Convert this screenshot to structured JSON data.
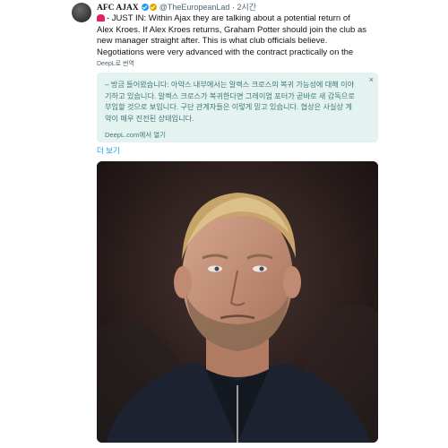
{
  "tweet": {
    "display_name": "AFC AJAX",
    "handle": "@TheEuropeanLad",
    "separator": "·",
    "time": "2시간",
    "text_lines": [
      "- JUST IN: Within Ajax they are talking about a potential return of",
      "Alex Kroes. If Alex Kroes returns, Graham Potter should join the club as",
      "new manager straight after. This is what club officials believe.",
      "Negotiations were very advanced with the contract practically on the"
    ],
    "deepl_label": "DeepL로 번역",
    "show_more": "더 보기"
  },
  "translation": {
    "lines": [
      "– 방금 들어왔습니다: 아약스 내부에서는 알렉스 크로스의 복귀 가능성에 대해 이야",
      "기하고 있습니다. 알렉스 크로스가 복귀한다면 그레이엄 포터가 곧바로 새 감독으로",
      "부임할 것으로 보입니다. 구단 관계자들은 이렇게 믿고 있습니다. 협상은 사실상 계",
      "약이 매우 진전된 상태입니다."
    ],
    "close_symbol": "×",
    "open_link": "DeepL.com에서 열기"
  },
  "media": {
    "description": "photo of a man"
  },
  "colors": {
    "link": "#1d9bf0",
    "translation_bg": "#e4f2f0",
    "translation_text": "#3a7a78",
    "verified": "#1d9bf0",
    "affiliate_badge": "#e0a400"
  }
}
